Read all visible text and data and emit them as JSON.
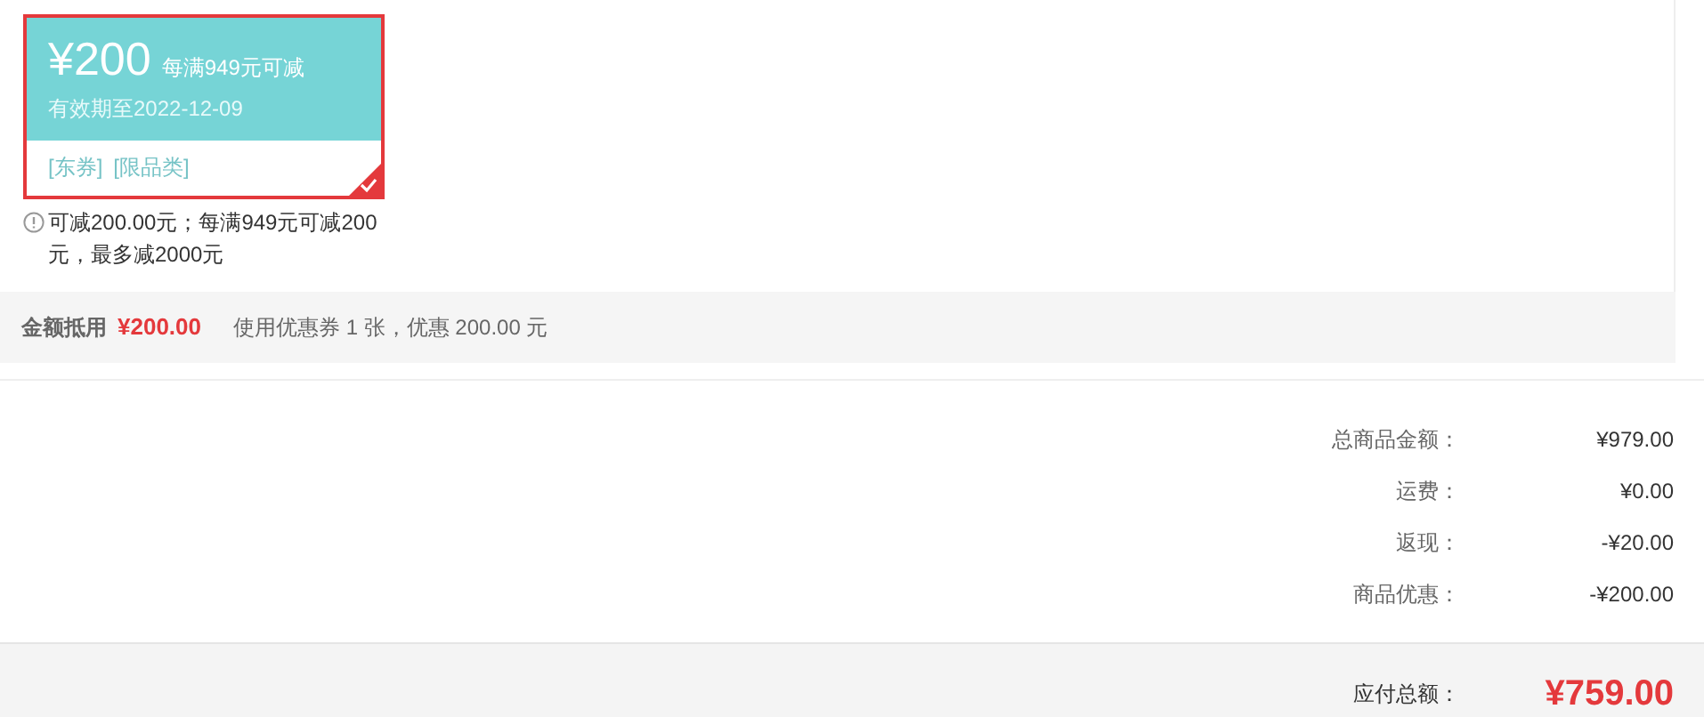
{
  "coupon": {
    "amount": "¥200",
    "condition": "每满949元可减",
    "validity": "有效期至2022-12-09",
    "tags": [
      "[东券]",
      "[限品类]"
    ],
    "selected": true,
    "note": "可减200.00元；每满949元可减200元，最多减2000元"
  },
  "deduction": {
    "label": "金额抵用",
    "amount": "¥200.00",
    "summary": "使用优惠券 1 张，优惠 200.00 元"
  },
  "totals": [
    {
      "label": "总商品金额：",
      "value": "¥979.00"
    },
    {
      "label": "运费：",
      "value": "¥0.00"
    },
    {
      "label": "返现：",
      "value": "-¥20.00"
    },
    {
      "label": "商品优惠：",
      "value": "-¥200.00"
    }
  ],
  "payable": {
    "label": "应付总额：",
    "value": "¥759.00"
  }
}
